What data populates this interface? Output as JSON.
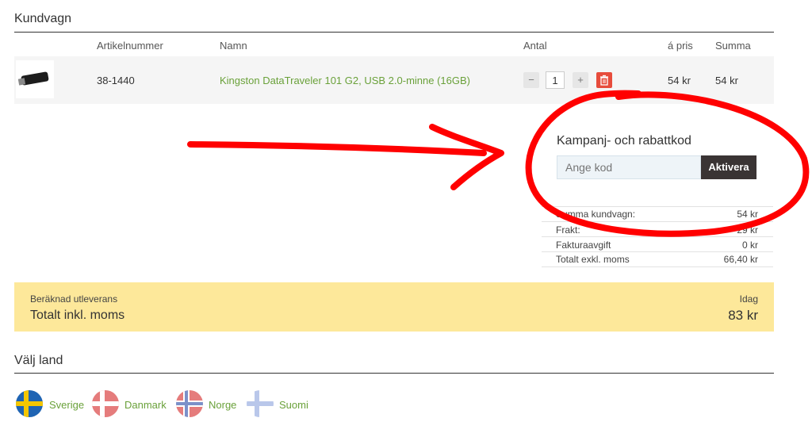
{
  "cart": {
    "title": "Kundvagn",
    "headers": {
      "article": "Artikelnummer",
      "name": "Namn",
      "qty": "Antal",
      "price": "á pris",
      "sum": "Summa"
    },
    "item": {
      "article": "38-1440",
      "name": "Kingston DataTraveler 101 G2, USB 2.0-minne (16GB)",
      "qty": "1",
      "minus": "−",
      "plus": "+",
      "price": "54 kr",
      "sum": "54 kr"
    }
  },
  "promo": {
    "title": "Kampanj- och rabattkod",
    "placeholder": "Ange kod",
    "button": "Aktivera"
  },
  "summary": {
    "rows": [
      {
        "label": "Summa kundvagn:",
        "value": "54 kr"
      },
      {
        "label": "Frakt:",
        "value": "29 kr"
      },
      {
        "label": "Fakturaavgift",
        "value": "0 kr"
      },
      {
        "label": "Totalt exkl. moms",
        "value": "66,40 kr"
      }
    ]
  },
  "delivery": {
    "label": "Beräknad utleverans",
    "value": "Idag",
    "total_label": "Totalt inkl. moms",
    "total_value": "83 kr"
  },
  "country": {
    "title": "Välj land",
    "options": [
      {
        "label": "Sverige"
      },
      {
        "label": "Danmark"
      },
      {
        "label": "Norge"
      },
      {
        "label": "Suomi"
      }
    ]
  }
}
